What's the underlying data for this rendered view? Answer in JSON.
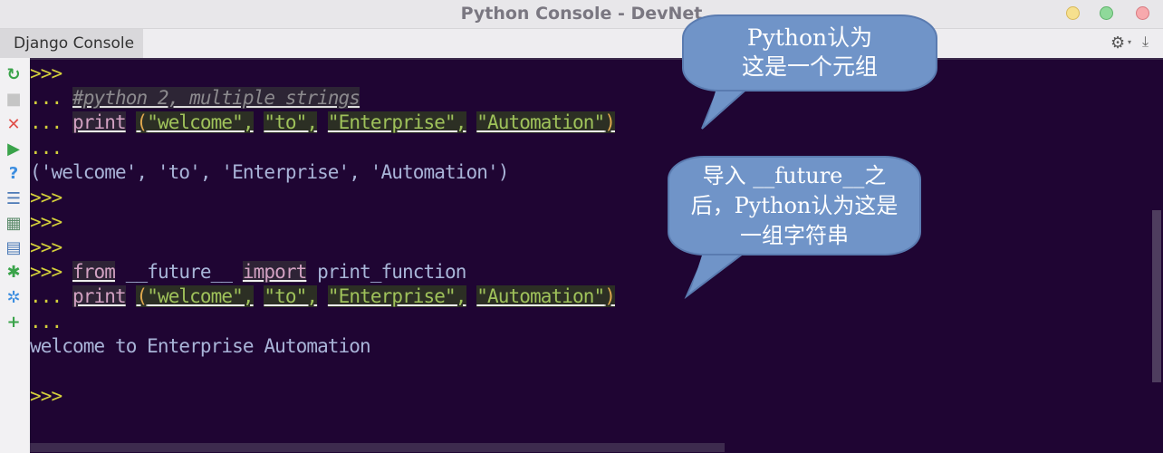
{
  "window": {
    "title": "Python Console - DevNet",
    "controls": {
      "minimize": "minimize",
      "maximize": "maximize",
      "close": "close"
    },
    "colors": {
      "minimize": "#f6e08e",
      "maximize": "#8fd99a",
      "close": "#f7a9ad"
    }
  },
  "tabbar": {
    "tab_label": "Django Console",
    "settings_icon": "⚙",
    "settings_caret": "▾",
    "pin_icon": "⤓"
  },
  "toolbar": {
    "items": [
      {
        "name": "rerun-icon",
        "glyph": "↻",
        "color": "#3aa34a"
      },
      {
        "name": "stop-icon",
        "glyph": "■",
        "color": "#c5c5c5"
      },
      {
        "name": "close-icon",
        "glyph": "✕",
        "color": "#e0504a"
      },
      {
        "name": "execute-icon",
        "glyph": "▶",
        "color": "#3aa34a"
      },
      {
        "name": "help-icon",
        "glyph": "?",
        "color": "#3d8ee0"
      },
      {
        "name": "settings-list-icon",
        "glyph": "☰",
        "color": "#4b79b6"
      },
      {
        "name": "variables-icon",
        "glyph": "▦",
        "color": "#5b8a6a"
      },
      {
        "name": "history-icon",
        "glyph": "▤",
        "color": "#4b79b6"
      },
      {
        "name": "debug-icon",
        "glyph": "✱",
        "color": "#3aa34a"
      },
      {
        "name": "console-settings-icon",
        "glyph": "✲",
        "color": "#3d8ee0"
      },
      {
        "name": "new-console-icon",
        "glyph": "+",
        "color": "#3aa34a"
      }
    ]
  },
  "console": {
    "colors": {
      "background": "#1f0533",
      "prompt": "#d4d03b",
      "string": "#9fc25a",
      "keyword": "#d2a1c2",
      "output": "#a9b4d8"
    },
    "lines": [
      {
        "prompt": ">>>",
        "segments": []
      },
      {
        "prompt": "...",
        "segments": [
          {
            "t": "#python 2, multiple strings",
            "c": "cmt"
          }
        ]
      },
      {
        "prompt": "...",
        "segments": [
          {
            "t": "print",
            "c": "kw"
          },
          {
            "t": " ",
            "c": ""
          },
          {
            "t": "(",
            "c": "paren"
          },
          {
            "t": "\"welcome\",",
            "c": "str"
          },
          {
            "t": " ",
            "c": ""
          },
          {
            "t": "\"to\",",
            "c": "str"
          },
          {
            "t": " ",
            "c": ""
          },
          {
            "t": "\"Enterprise\",",
            "c": "str"
          },
          {
            "t": " ",
            "c": ""
          },
          {
            "t": "\"Automation\"",
            "c": "str"
          },
          {
            "t": ")",
            "c": "paren"
          }
        ]
      },
      {
        "prompt": "...",
        "segments": []
      },
      {
        "prompt": "",
        "segments": [
          {
            "t": "('welcome', 'to', 'Enterprise', 'Automation')",
            "c": "out"
          }
        ]
      },
      {
        "prompt": ">>>",
        "segments": []
      },
      {
        "prompt": ">>>",
        "segments": []
      },
      {
        "prompt": ">>>",
        "segments": []
      },
      {
        "prompt": ">>>",
        "segments": [
          {
            "t": "from",
            "c": "kw"
          },
          {
            "t": " __future__ ",
            "c": "plain"
          },
          {
            "t": "import",
            "c": "kw"
          },
          {
            "t": " print_function",
            "c": "plain"
          }
        ]
      },
      {
        "prompt": "...",
        "segments": [
          {
            "t": "print",
            "c": "kw"
          },
          {
            "t": " ",
            "c": ""
          },
          {
            "t": "(",
            "c": "paren"
          },
          {
            "t": "\"welcome\",",
            "c": "str"
          },
          {
            "t": " ",
            "c": ""
          },
          {
            "t": "\"to\",",
            "c": "str"
          },
          {
            "t": " ",
            "c": ""
          },
          {
            "t": "\"Enterprise\",",
            "c": "str"
          },
          {
            "t": " ",
            "c": ""
          },
          {
            "t": "\"Automation\"",
            "c": "str"
          },
          {
            "t": ")",
            "c": "paren"
          }
        ]
      },
      {
        "prompt": "...",
        "segments": []
      },
      {
        "prompt": "",
        "segments": [
          {
            "t": "welcome to Enterprise Automation",
            "c": "out"
          }
        ]
      },
      {
        "prompt": "",
        "segments": []
      },
      {
        "prompt": ">>>",
        "segments": []
      }
    ]
  },
  "callouts": {
    "tuple_note": {
      "line1": "Python认为",
      "line2": "这是一个元组"
    },
    "future_note": {
      "line1": "导入 __future__之",
      "line2": "后，Python认为这是",
      "line3": "一组字符串"
    },
    "color": "#7094c8"
  }
}
